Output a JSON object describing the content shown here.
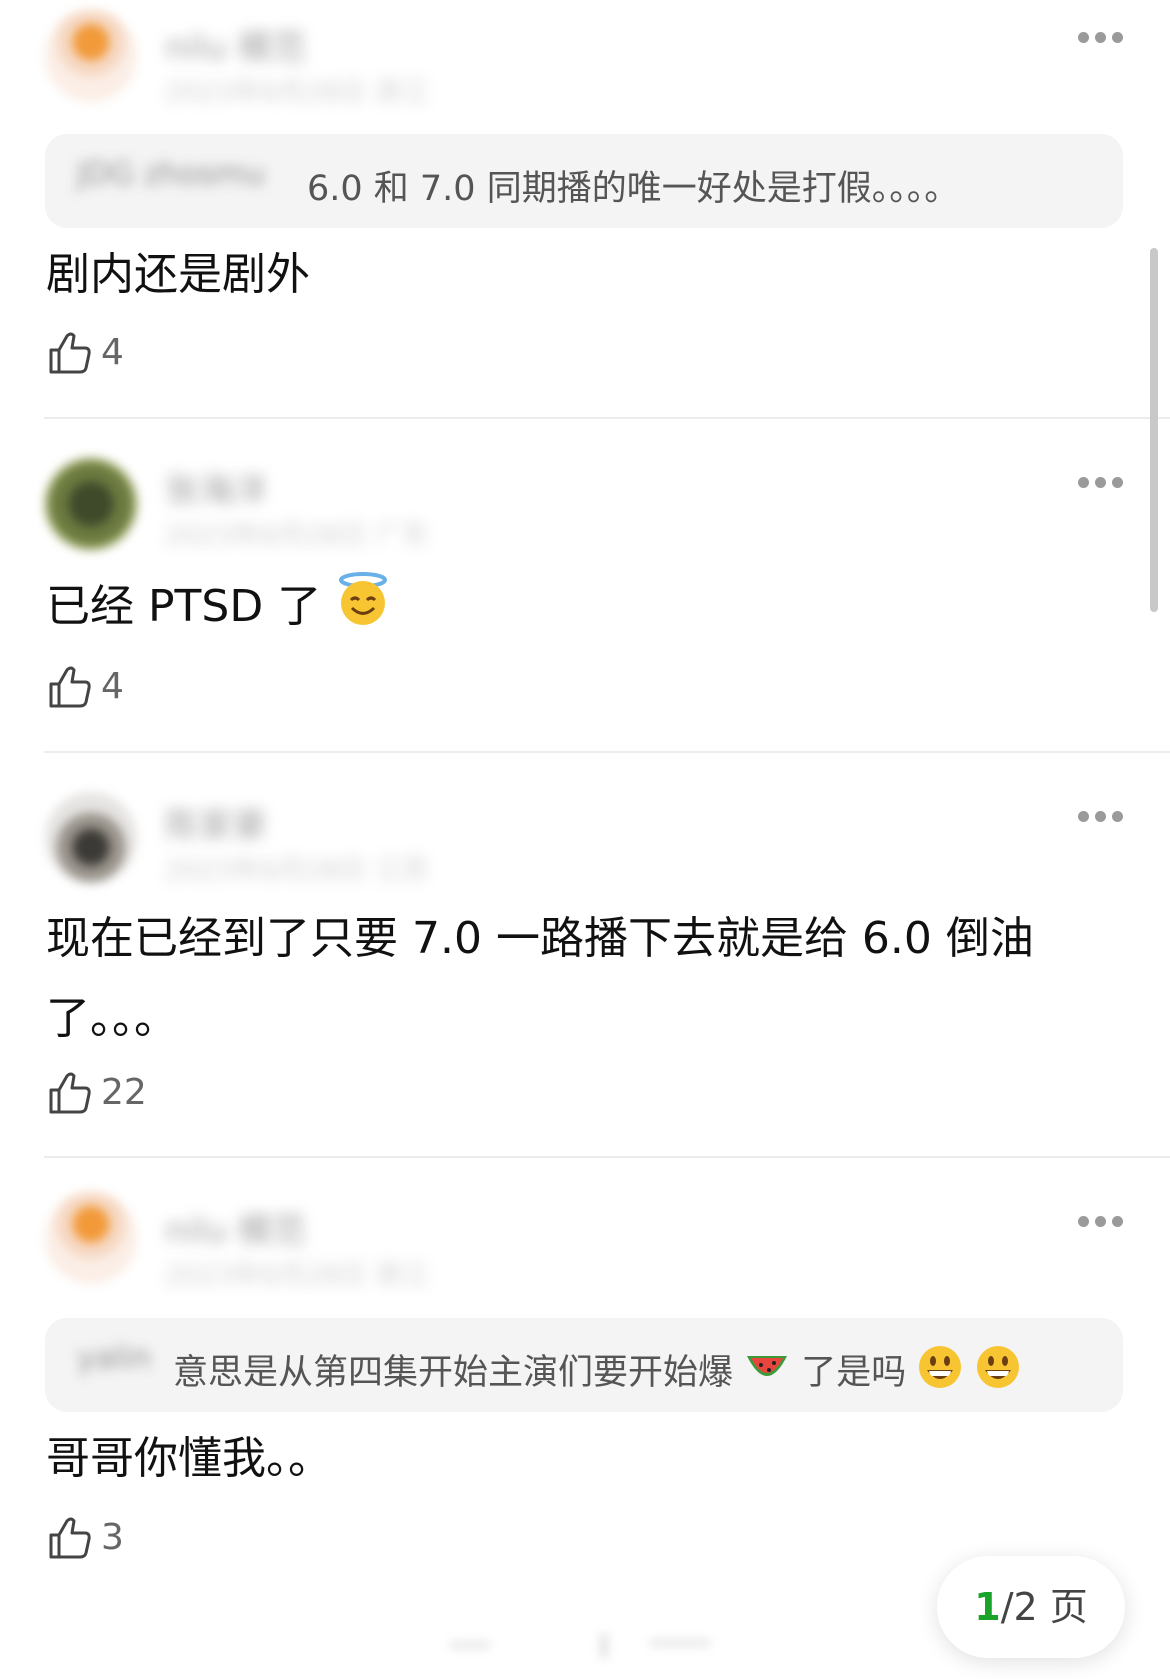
{
  "comments": [
    {
      "name": "nilu 模范",
      "meta": "2023年6月28日 浙江",
      "quote_name": "JDG zhosmu",
      "quote_text": "6.0 和 7.0 同期播的唯一好处是打假。。。。",
      "text": "剧内还是剧外",
      "likes": "4"
    },
    {
      "name": "张海洋",
      "meta": "2023年6月28日 广东",
      "text": "已经 PTSD 了",
      "emoji": "smiling-face-with-halo-emoji",
      "likes": "4"
    },
    {
      "name": "陈家豪",
      "meta": "2023年6月28日 江苏",
      "text_line1": "现在已经到了只要 7.0 一路播下去就是给 6.0 倒油",
      "text_line2": "了。。。",
      "likes": "22"
    },
    {
      "name": "nilu 模范",
      "meta": "2023年6月28日 浙江",
      "quote_name": "yalin",
      "quote_text": "意思是从第四集开始主演们要开始爆",
      "quote_text_after": "了是吗",
      "text": "哥哥你懂我。。",
      "likes": "3"
    }
  ],
  "pager": {
    "current": "1",
    "rest": "/2 页"
  },
  "colors": {
    "accent": "#1aa32a",
    "quote_bg": "#f4f4f4",
    "divider": "#ececec"
  }
}
